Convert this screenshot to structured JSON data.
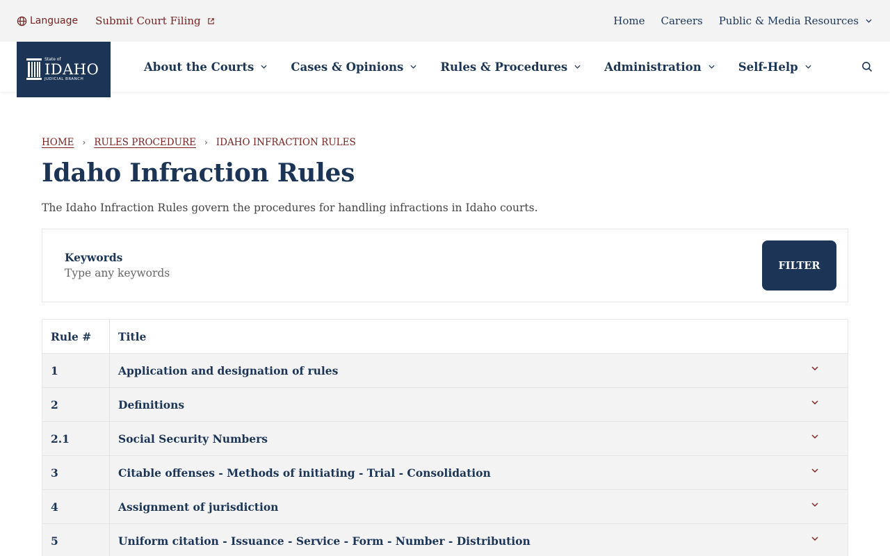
{
  "utility": {
    "language_label": "Language",
    "submit_label": "Submit Court Filing",
    "links": [
      "Home",
      "Careers",
      "Public & Media Resources"
    ]
  },
  "logo": {
    "top": "State of",
    "main": "IDAHO",
    "sub": "JUDICIAL BRANCH"
  },
  "nav": {
    "items": [
      "About the Courts",
      "Cases & Opinions",
      "Rules & Procedures",
      "Administration",
      "Self-Help"
    ]
  },
  "breadcrumb": {
    "home": "HOME",
    "parent": "RULES PROCEDURE",
    "current": "IDAHO INFRACTION RULES"
  },
  "page": {
    "title": "Idaho Infraction Rules",
    "description": "The Idaho Infraction Rules govern the procedures for handling infractions in Idaho courts."
  },
  "filter": {
    "label": "Keywords",
    "placeholder": "Type any keywords",
    "button": "FILTER"
  },
  "table": {
    "headers": [
      "Rule #",
      "Title"
    ],
    "rows": [
      {
        "num": "1",
        "title": "Application and designation of rules"
      },
      {
        "num": "2",
        "title": "Definitions"
      },
      {
        "num": "2.1",
        "title": "Social Security Numbers"
      },
      {
        "num": "3",
        "title": "Citable offenses - Methods of initiating - Trial - Consolidation"
      },
      {
        "num": "4",
        "title": "Assignment of jurisdiction"
      },
      {
        "num": "5",
        "title": "Uniform citation - Issuance - Service - Form - Number - Distribution"
      }
    ]
  },
  "colors": {
    "navy": "#1c3557",
    "maroon": "#7a1f1f",
    "utility_bg": "#f3f3f4",
    "row_bg": "#f3f3f4"
  }
}
